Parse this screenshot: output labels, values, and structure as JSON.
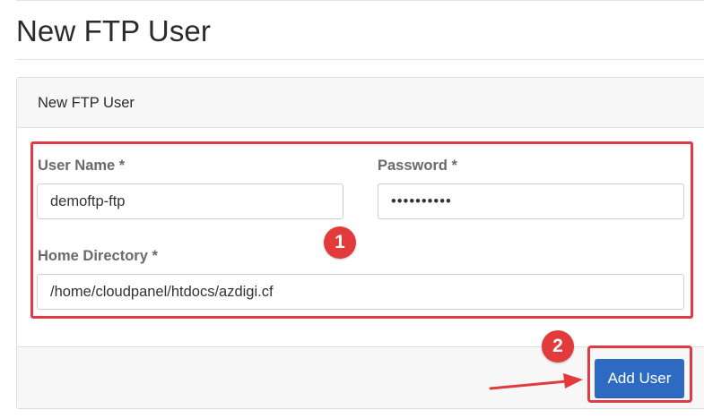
{
  "page": {
    "title": "New FTP User"
  },
  "card": {
    "header_title": "New FTP User"
  },
  "form": {
    "username": {
      "label": "User Name *",
      "value": "demoftp-ftp"
    },
    "password": {
      "label": "Password *",
      "value": "••••••••••"
    },
    "home_directory": {
      "label": "Home Directory *",
      "value": "/home/cloudpanel/htdocs/azdigi.cf"
    }
  },
  "actions": {
    "add_user_label": "Add User"
  },
  "annotations": {
    "badge_1": "1",
    "badge_2": "2",
    "highlight_color": "#e03a45",
    "badge_color": "#e23b3b"
  },
  "colors": {
    "primary_button": "#2d6bc2"
  }
}
